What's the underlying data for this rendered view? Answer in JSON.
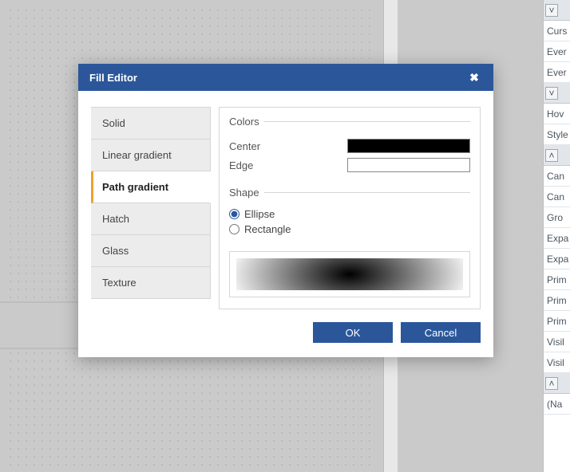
{
  "dialog": {
    "title": "Fill Editor",
    "tabs": [
      {
        "label": "Solid",
        "selected": false
      },
      {
        "label": "Linear gradient",
        "selected": false
      },
      {
        "label": "Path gradient",
        "selected": true
      },
      {
        "label": "Hatch",
        "selected": false
      },
      {
        "label": "Glass",
        "selected": false
      },
      {
        "label": "Texture",
        "selected": false
      }
    ],
    "colors": {
      "legend": "Colors",
      "center_label": "Center",
      "center_value": "#000000",
      "edge_label": "Edge",
      "edge_value": "#FFFFFF"
    },
    "shape": {
      "legend": "Shape",
      "options": [
        {
          "label": "Ellipse",
          "value": "ellipse",
          "checked": true
        },
        {
          "label": "Rectangle",
          "value": "rectangle",
          "checked": false
        }
      ]
    },
    "buttons": {
      "ok": "OK",
      "cancel": "Cancel"
    }
  },
  "side_panel": {
    "rows": [
      {
        "type": "header"
      },
      {
        "label": "Curs"
      },
      {
        "label": "Ever"
      },
      {
        "label": "Ever"
      },
      {
        "type": "header"
      },
      {
        "label": "Hov"
      },
      {
        "label": "Style"
      },
      {
        "type": "header",
        "variant": "up"
      },
      {
        "label": "Can"
      },
      {
        "label": "Can"
      },
      {
        "label": "Gro"
      },
      {
        "label": "Expa"
      },
      {
        "label": "Expa"
      },
      {
        "label": "Prim"
      },
      {
        "label": "Prim"
      },
      {
        "label": "Prim"
      },
      {
        "label": "Visil"
      },
      {
        "label": "Visil"
      },
      {
        "type": "header",
        "variant": "up"
      },
      {
        "label": "(Na"
      }
    ]
  }
}
